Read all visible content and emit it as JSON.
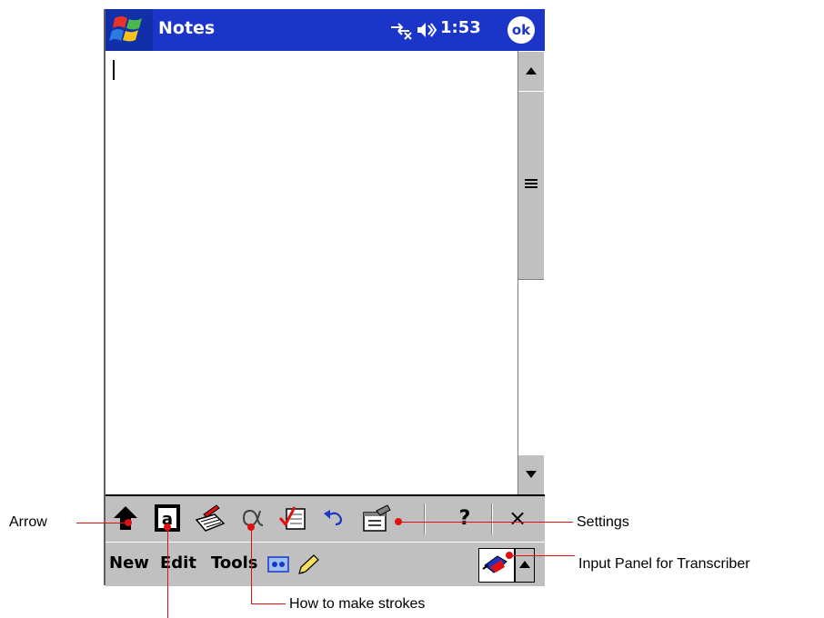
{
  "window": {
    "title": "Notes",
    "clock": "1:53",
    "ok_label": "ok"
  },
  "toolbar": {
    "items": [
      {
        "name": "arrow-up-icon"
      },
      {
        "name": "letter-a-icon",
        "glyph": "a"
      },
      {
        "name": "keyboard-pen-icon"
      },
      {
        "name": "alpha-icon",
        "glyph": "α"
      },
      {
        "name": "checklist-icon"
      },
      {
        "name": "undo-icon",
        "glyph": "↶"
      },
      {
        "name": "settings-icon"
      },
      {
        "name": "help-icon",
        "glyph": "?"
      },
      {
        "name": "close-icon",
        "glyph": "×"
      }
    ]
  },
  "menubar": {
    "new": "New",
    "edit": "Edit",
    "tools": "Tools"
  },
  "callouts": {
    "arrow": "Arrow",
    "settings": "Settings",
    "input_panel": "Input Panel for Transcriber",
    "strokes": "How to make strokes"
  },
  "colors": {
    "titlebar": "#1a35c8",
    "chrome": "#c0c0c0",
    "callout_line": "#e01010"
  }
}
